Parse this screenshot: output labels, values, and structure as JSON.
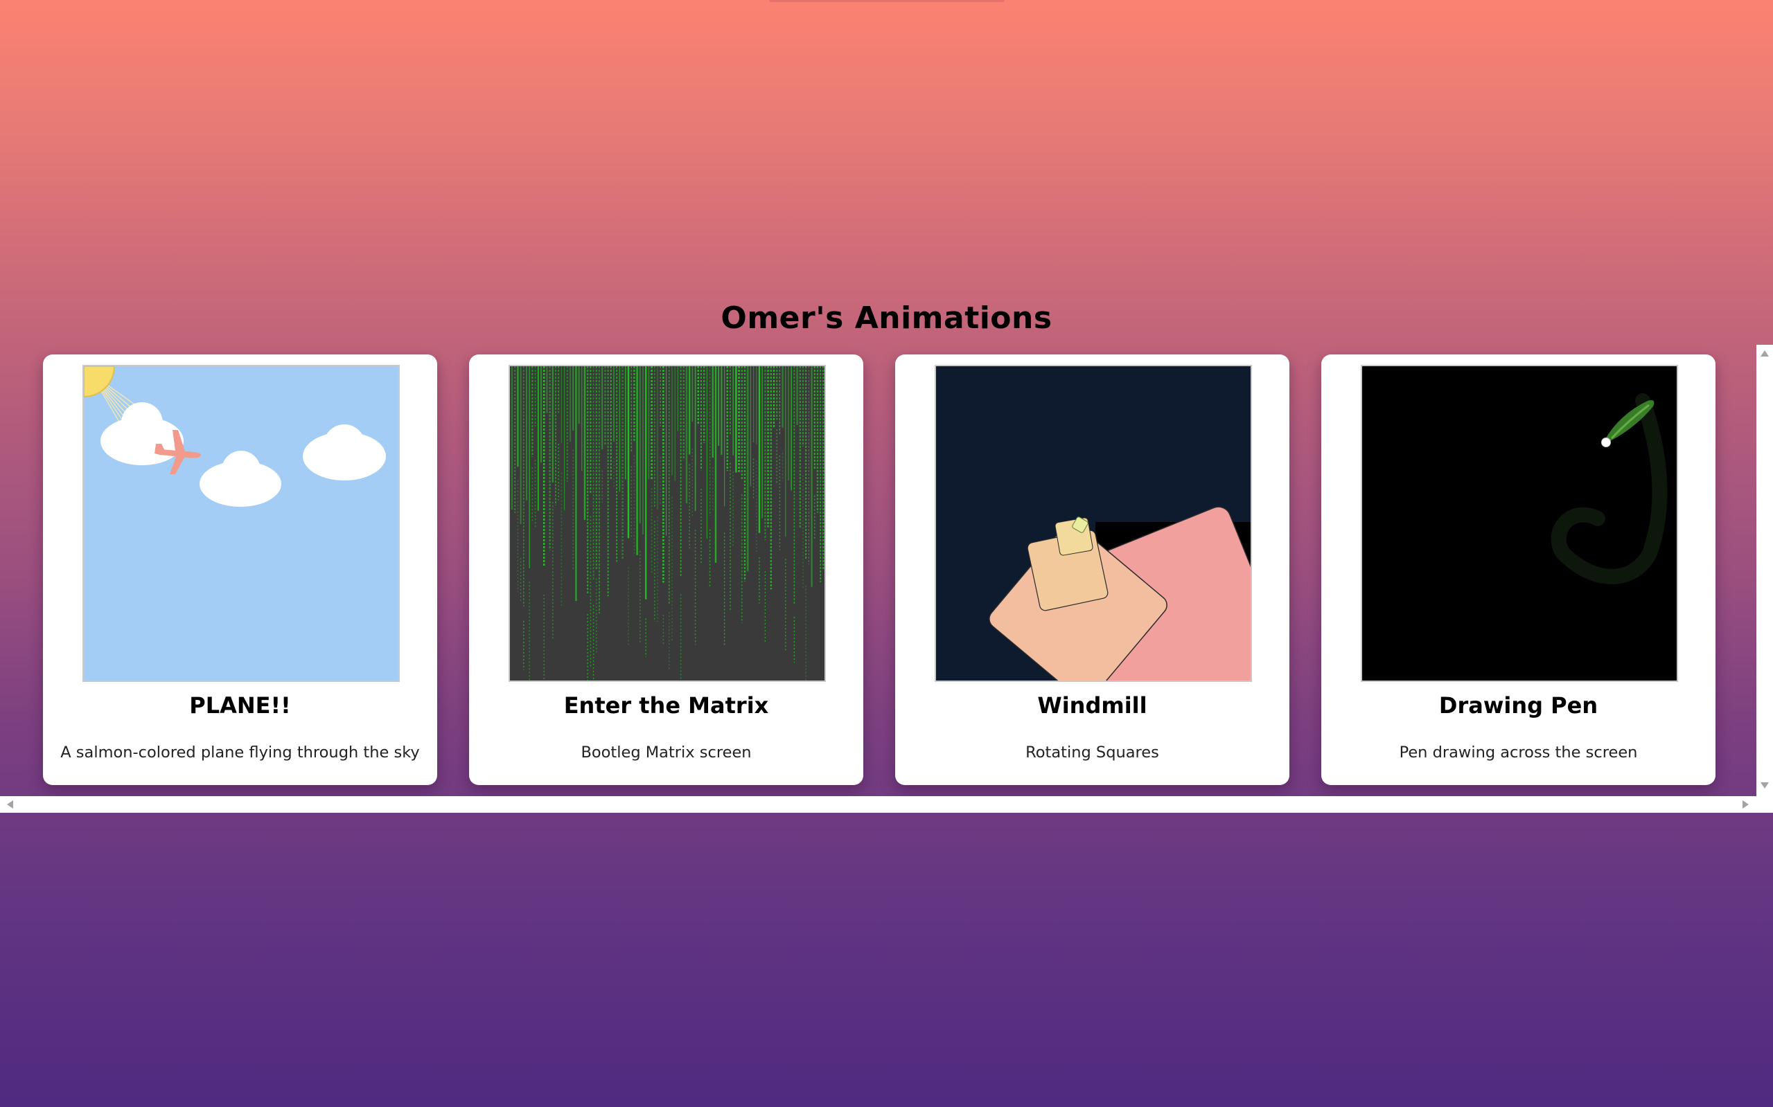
{
  "page": {
    "title": "Omer's Animations",
    "background_top": "#fb8272",
    "background_bottom": "#4f2a80"
  },
  "cards": [
    {
      "title": "PLANE!!",
      "description": "A salmon-colored plane flying through the sky",
      "preview": "sky-with-plane-clouds-sun",
      "colors": {
        "sky": "#a3cdf5",
        "plane": "#f29a8c",
        "sun": "#f7dc6a",
        "cloud": "#ffffff"
      }
    },
    {
      "title": "Enter the Matrix",
      "description": "Bootleg Matrix screen",
      "preview": "matrix-green-rain",
      "colors": {
        "background": "#3a3a3a",
        "rain": "#22c522"
      }
    },
    {
      "title": "Windmill",
      "description": "Rotating Squares",
      "preview": "rotating-squares",
      "colors": {
        "background": "#0e1a2e",
        "large_square": "#f2a09d",
        "mid_square": "#f3bda0",
        "small_square": "#f2d39b",
        "tiny_square": "#e8eda0"
      }
    },
    {
      "title": "Drawing Pen",
      "description": "Pen drawing across the screen",
      "preview": "pen-drawing-trail",
      "colors": {
        "background": "#000000",
        "trail": "#3e8a2c",
        "pen": "#ffffff"
      }
    }
  ],
  "scrollbars": {
    "vertical": {
      "icons": [
        "scroll-up-arrow-icon",
        "scroll-down-arrow-icon"
      ]
    },
    "horizontal": {
      "icons": [
        "scroll-left-arrow-icon",
        "scroll-right-arrow-icon"
      ]
    }
  }
}
